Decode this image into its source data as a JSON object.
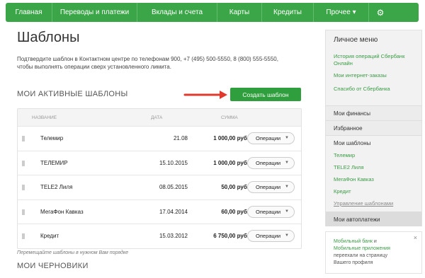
{
  "nav": {
    "items": [
      {
        "label": "Главная",
        "w": 66
      },
      {
        "label": "Переводы и платежи",
        "w": 120
      },
      {
        "label": "Вклады и счета",
        "w": 113
      },
      {
        "label": "Карты",
        "w": 63
      },
      {
        "label": "Кредиты",
        "w": 73
      },
      {
        "label": "Прочее ▾",
        "w": 78
      }
    ],
    "settings_icon": "gear-icon"
  },
  "page": {
    "title": "Шаблоны",
    "notice_line1": "Подтвердите шаблон в Контактном центре по телефонам 900, +7 (495) 500-5550, 8 (800) 555-5550,",
    "notice_line2": "чтобы выполнять операции сверх установленного лимита."
  },
  "templates": {
    "section_title": "МОИ АКТИВНЫЕ ШАБЛОНЫ",
    "create_button": "Создать шаблон",
    "headers": {
      "name": "НАЗВАНИЕ",
      "date": "ДАТА",
      "sum": "СУММА"
    },
    "rows": [
      {
        "name": "Телемир",
        "date": "21.08",
        "sum": "1 000,00 руб.",
        "ops": "Операции"
      },
      {
        "name": "ТЕЛЕМИР",
        "date": "15.10.2015",
        "sum": "1 000,00 руб.",
        "ops": "Операции"
      },
      {
        "name": "TELE2 Лиля",
        "date": "08.05.2015",
        "sum": "50,00 руб.",
        "ops": "Операции"
      },
      {
        "name": "МегаФон Кавказ",
        "date": "17.04.2014",
        "sum": "60,00 руб.",
        "ops": "Операции"
      },
      {
        "name": "Кредит",
        "date": "15.03.2012",
        "sum": "6 750,00 руб.",
        "ops": "Операции"
      }
    ],
    "hint": "Перемещайте шаблоны в нужном Вам порядке"
  },
  "drafts": {
    "section_title": "МОИ ЧЕРНОВИКИ"
  },
  "sidebar": {
    "title": "Личное меню",
    "links": [
      "История операций Сбербанк",
      "Онлайн",
      "Мои интернет-заказы",
      "Спасибо от Сбербанка"
    ],
    "sections": {
      "finances": "Мои финансы",
      "favorites": "Избранное",
      "templates": "Мои шаблоны",
      "autopay": "Мои автоплатежи"
    },
    "template_links": [
      "Телемир",
      "TELE2 Лиля",
      "МегаФон Кавказ",
      "Кредит",
      "Управление шаблонами"
    ]
  },
  "promo": {
    "p1": "Мобильный банк",
    "p2": " и",
    "p3": "Мобильные приложения",
    "p4": "переехали на страницу",
    "p5": "Вашего профиля",
    "close": "×"
  },
  "colors": {
    "brand_green": "#3aa647",
    "link_green": "#3a9a45",
    "arrow_red": "#e03a2f"
  }
}
